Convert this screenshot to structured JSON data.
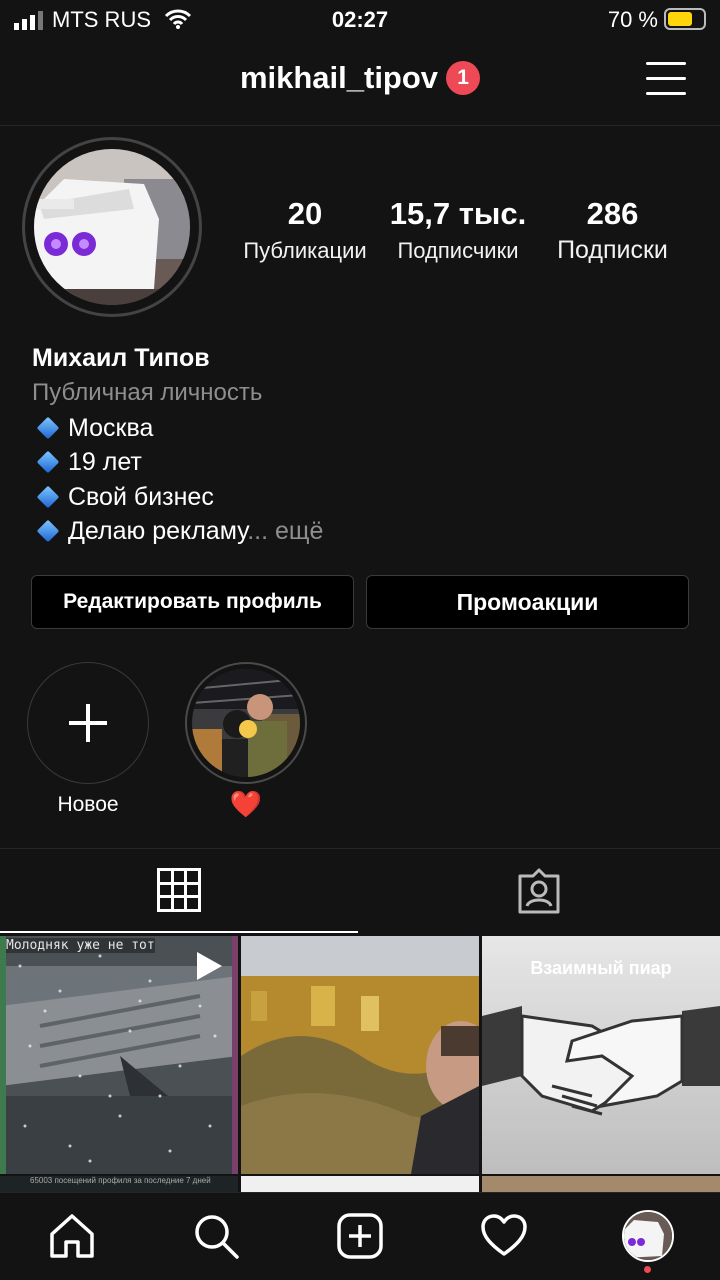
{
  "status_bar": {
    "carrier": "MTS RUS",
    "time": "02:27",
    "battery_percent_text": "70 %",
    "battery_level": 0.7
  },
  "header": {
    "username": "mikhail_tipov",
    "notification_count": "1"
  },
  "stats": [
    {
      "value": "20",
      "label": "Публикации"
    },
    {
      "value": "15,7 тыс.",
      "label": "Подписчики"
    },
    {
      "value": "286",
      "label": "Подписки"
    }
  ],
  "bio": {
    "name": "Михаил Типов",
    "category": "Публичная личность",
    "lines": [
      "Москва",
      "19 лет",
      "Свой бизнес",
      "Делаю рекламу"
    ],
    "more": "... ещё"
  },
  "buttons": {
    "edit_profile": "Редактировать профиль",
    "promotions": "Промоакции"
  },
  "highlights": [
    {
      "label": "Новое",
      "icon": "plus-icon"
    },
    {
      "label": "❤️",
      "icon": "story-thumbnail"
    }
  ],
  "grid_posts": [
    {
      "overlay_text": "Молодняк уже не тот",
      "caption_text": "65003 посещений профиля за последние 7 дней",
      "icon": "play-icon"
    },
    {
      "overlay_text": ""
    },
    {
      "overlay_text": "Взаимный пиар"
    }
  ],
  "nav": {
    "icons": [
      "home-icon",
      "search-icon",
      "new-post-icon",
      "activity-heart-icon",
      "profile-avatar"
    ]
  },
  "colors": {
    "background": "#131313",
    "badge": "#ed4956",
    "battery": "#ffd60a",
    "muted_text": "#8e8e8e"
  }
}
